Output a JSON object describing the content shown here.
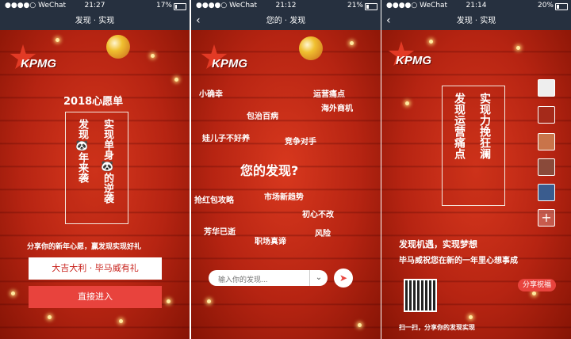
{
  "panels": [
    {
      "status": {
        "carrier": "●●●●○ WeChat",
        "time": "21:27",
        "battery": "17%"
      },
      "nav_title": "发现 · 实现",
      "logo": "KPMG",
      "heading": "2018心愿单",
      "card_left": "发现🐼年来袭",
      "card_right": "实现单身🐼的逆袭",
      "share_text": "分享你的新年心愿，赢发现实现好礼",
      "input_value": "大吉大利 · 毕马威有礼",
      "enter_button": "直接进入"
    },
    {
      "status": {
        "carrier": "●●●●○ WeChat",
        "time": "21:12",
        "battery": "21%"
      },
      "nav_title": "您的 · 发现",
      "logo": "KPMG",
      "tags": [
        "小确幸",
        "运营痛点",
        "包治百病",
        "海外商机",
        "娃儿子不好养",
        "竞争对手",
        "您的发现?",
        "抢红包攻略",
        "市场新趋势",
        "初心不改",
        "芳华已逝",
        "职场真谛",
        "风险"
      ],
      "search_placeholder": "输入你的发现..."
    },
    {
      "status": {
        "carrier": "●●●●○ WeChat",
        "time": "21:14",
        "battery": "20%"
      },
      "nav_title": "发现 · 实现",
      "logo": "KPMG",
      "card_left": "发现运营痛点",
      "card_right": "实现力挽狂澜",
      "line1": "发现机遇，实现梦想",
      "line2": "毕马威祝您在新的一年里心想事成",
      "share_button": "分享祝福",
      "qr_caption": "扫一扫，分享你的发现实现"
    }
  ]
}
